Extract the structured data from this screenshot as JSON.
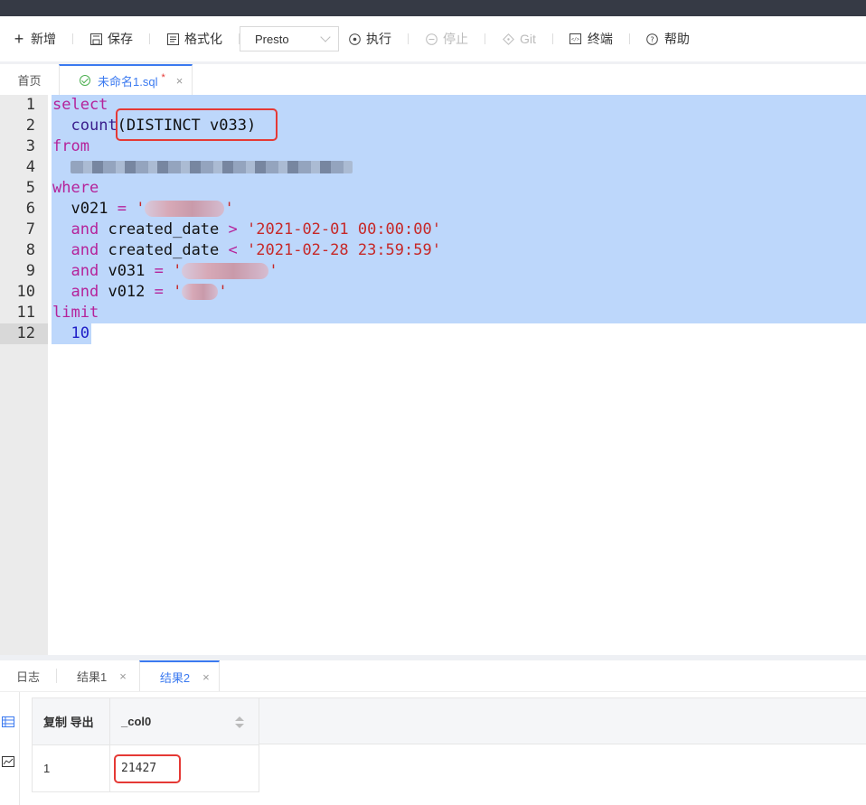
{
  "toolbar": {
    "new_label": "新增",
    "save_label": "保存",
    "format_label": "格式化",
    "engine_selected": "Presto",
    "run_label": "执行",
    "stop_label": "停止",
    "git_label": "Git",
    "terminal_label": "终端",
    "help_label": "帮助"
  },
  "tabs": {
    "home": "首页",
    "active_file": "未命名1.sql",
    "dirty_marker": "*",
    "close": "×"
  },
  "editor": {
    "line_numbers": [
      "1",
      "2",
      "3",
      "4",
      "5",
      "6",
      "7",
      "8",
      "9",
      "10",
      "11",
      "12"
    ],
    "lines": {
      "l1": {
        "kw": "select"
      },
      "l2": {
        "fn": "count",
        "rest": "(DISTINCT v033)"
      },
      "l3": {
        "kw": "from"
      },
      "l5": {
        "kw": "where"
      },
      "l6": {
        "id": "v021",
        "op": "=",
        "q1": "'",
        "q2": "'"
      },
      "l7": {
        "kw": "and",
        "id": "created_date",
        "op": ">",
        "str": "'2021-02-01 00:00:00'"
      },
      "l8": {
        "kw": "and",
        "id": "created_date",
        "op": "<",
        "str": "'2021-02-28 23:59:59'"
      },
      "l9": {
        "kw": "and",
        "id": "v031",
        "op": "=",
        "q1": "'",
        "q2": "'"
      },
      "l10": {
        "kw": "and",
        "id": "v012",
        "op": "=",
        "q1": "'",
        "q2": "'"
      },
      "l11": {
        "kw": "limit"
      },
      "l12": {
        "num": "10"
      }
    },
    "current_line": 12
  },
  "result_tabs": {
    "log": "日志",
    "result1": "结果1",
    "result2": "结果2",
    "close": "×"
  },
  "results": {
    "actions_header": "复制 导出",
    "column_header": "_col0",
    "rows": [
      {
        "index": "1",
        "value": "21427"
      }
    ]
  },
  "colors": {
    "accent": "#3b7af0",
    "selection": "#bdd7fb",
    "highlight_box": "#e53935",
    "topbar": "#363a45"
  }
}
